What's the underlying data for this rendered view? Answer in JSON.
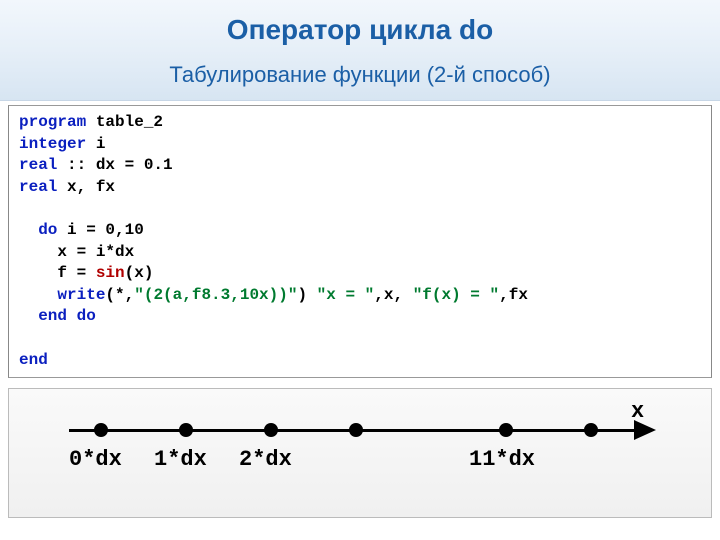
{
  "header": {
    "title": "Оператор цикла  do",
    "subtitle": "Табулирование функции   (2-й способ)"
  },
  "code": {
    "l1a": "program",
    "l1b": " table_2",
    "l2a": "integer",
    "l2b": " i",
    "l3a": "real",
    "l3b": " :: dx = 0.1",
    "l4a": "real",
    "l4b": " x, fx",
    "l5": " ",
    "l6a": "  do",
    "l6b": " i = 0,10",
    "l7": "    x = i*dx",
    "l8a": "    f = ",
    "l8b": "sin",
    "l8c": "(x)",
    "l9a": "    write",
    "l9b": "(*,",
    "l9c": "\"(2(a,f8.3,10x))\"",
    "l9d": ") ",
    "l9e": "\"x = \"",
    "l9f": ",x, ",
    "l9g": "\"f(x) = \"",
    "l9h": ",fx",
    "l10": "  end do",
    "l11": " ",
    "l12": "end"
  },
  "diagram": {
    "x_label": "x",
    "ticks": {
      "t0": "0*dx",
      "t1": "1*dx",
      "t2": "2*dx",
      "t11": "11*dx"
    }
  }
}
